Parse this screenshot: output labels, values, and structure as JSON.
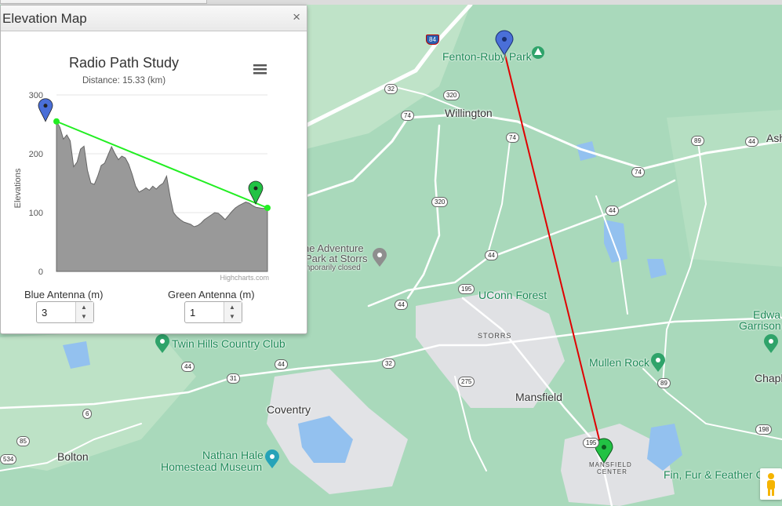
{
  "dialog": {
    "title": "Elevation Map",
    "close_glyph": "×"
  },
  "chart_data": {
    "type": "area",
    "title": "Radio Path Study",
    "subtitle": "Distance: 15.33 (km)",
    "ylabel": "Elevations",
    "credits": "Highcharts.com",
    "ylim": [
      0,
      300
    ],
    "yticks": [
      0,
      100,
      200,
      300
    ],
    "grid": true,
    "x": [
      0,
      0.25,
      0.5,
      0.75,
      1.0,
      1.25,
      1.5,
      1.75,
      2.0,
      2.25,
      2.5,
      2.75,
      3.0,
      3.25,
      3.5,
      3.75,
      4.0,
      4.25,
      4.5,
      4.75,
      5.0,
      5.25,
      5.5,
      5.75,
      6.0,
      6.25,
      6.5,
      6.75,
      7.0,
      7.25,
      7.5,
      7.75,
      8.0,
      8.25,
      8.5,
      8.75,
      9.0,
      9.25,
      9.5,
      9.75,
      10.0,
      10.25,
      10.5,
      10.75,
      11.0,
      11.25,
      11.5,
      11.75,
      12.0,
      12.25,
      12.5,
      12.75,
      13.0,
      13.25,
      13.5,
      13.75,
      14.0,
      14.25,
      14.5,
      14.75,
      15.0,
      15.33
    ],
    "elevation": [
      255,
      245,
      225,
      232,
      222,
      178,
      186,
      208,
      213,
      172,
      150,
      148,
      162,
      180,
      184,
      198,
      212,
      200,
      190,
      196,
      193,
      182,
      165,
      145,
      135,
      138,
      142,
      138,
      145,
      140,
      146,
      150,
      162,
      128,
      100,
      93,
      88,
      84,
      82,
      80,
      76,
      78,
      82,
      88,
      92,
      96,
      100,
      99,
      94,
      88,
      95,
      102,
      108,
      112,
      115,
      118,
      116,
      112,
      109,
      108,
      107,
      108
    ],
    "los_line": [
      [
        0,
        255
      ],
      [
        15.33,
        108
      ]
    ],
    "series": [
      {
        "name": "Elevation",
        "color": "#8a8a8a"
      },
      {
        "name": "Line of sight",
        "color": "#22ee22"
      }
    ],
    "markers": [
      {
        "name": "blue-antenna",
        "x": 0,
        "y": 255,
        "color": "#4a6fd8"
      },
      {
        "name": "green-antenna",
        "x": 15.33,
        "y": 108,
        "color": "#22c244"
      }
    ]
  },
  "antennas": {
    "blue_label": "Blue Antenna (m)",
    "blue_value": "3",
    "green_label": "Green Antenna (m)",
    "green_value": "1"
  },
  "map": {
    "colors": {
      "forest": "#a8d8b9",
      "urban": "#dfe0e3",
      "water": "#93c1ef",
      "road": "#ffffff",
      "path": "#e00000"
    },
    "towns": [
      "Willington",
      "Mansfield",
      "Coventry",
      "Bolton",
      "Chapl",
      "Ash"
    ],
    "small_labels": [
      "STORRS",
      "MANSFIELD",
      "CENTER"
    ],
    "pois": [
      "Fenton-Ruby Park",
      "UConn Forest",
      "Mullen Rock",
      "Twin Hills Country Club",
      "Nathan Hale",
      "Homestead Museum",
      "Fin, Fur & Feather C",
      "Edwa",
      "Garrison"
    ],
    "closed_poi": [
      "ne Adventure",
      "Park at Storrs",
      "mporarily closed"
    ],
    "interstate": [
      "84"
    ],
    "route_shields": [
      "32",
      "320",
      "74",
      "74",
      "89",
      "44",
      "74",
      "44",
      "320",
      "44",
      "195",
      "44",
      "44",
      "44",
      "32",
      "31",
      "275",
      "89",
      "6",
      "85",
      "534",
      "198",
      "195"
    ]
  }
}
